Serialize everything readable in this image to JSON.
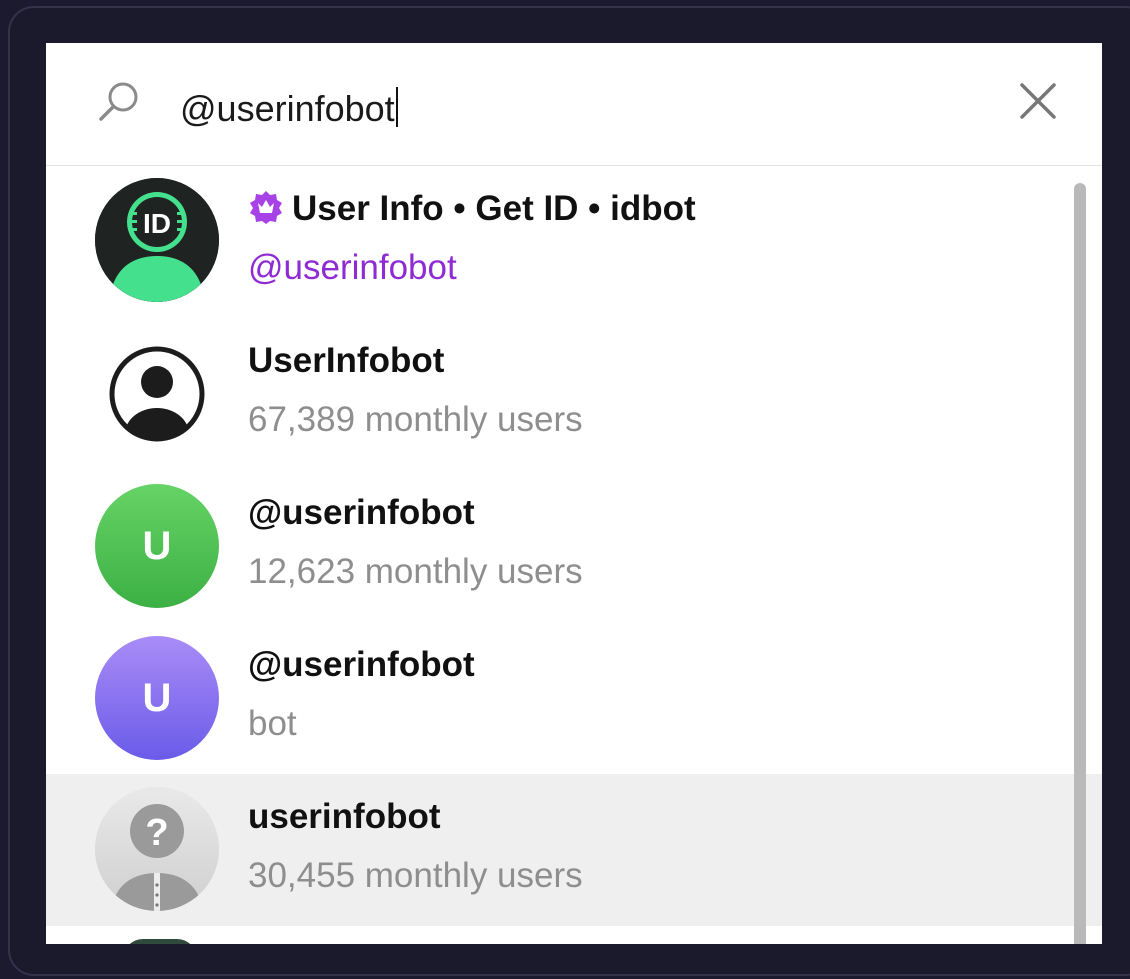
{
  "search": {
    "query": "@userinfobot"
  },
  "results": [
    {
      "title": "User Info • Get ID • idbot",
      "subtitle": "@userinfobot",
      "avatar_icon": "id-bot-avatar",
      "avatar_text": "ID",
      "badge_icon": "verified-badge-icon"
    },
    {
      "title": "UserInfobot",
      "subtitle": "67,389 monthly users",
      "avatar_icon": "user-outline-avatar"
    },
    {
      "title": "@userinfobot",
      "subtitle": "12,623 monthly users",
      "avatar_letter": "U",
      "avatar_color": "#4cc24e"
    },
    {
      "title": "@userinfobot",
      "subtitle": "bot",
      "avatar_letter": "U",
      "avatar_color": "#8a73f0"
    },
    {
      "title": "userinfobot",
      "subtitle": "30,455 monthly users",
      "avatar_icon": "unknown-user-avatar",
      "highlighted": true
    }
  ],
  "colors": {
    "accent_purple": "#8e2bd3",
    "badge_purple": "#a743e6",
    "secondary_text": "#8e8e8e",
    "highlight_row": "#efefef",
    "page_background": "#1c1a2e"
  }
}
